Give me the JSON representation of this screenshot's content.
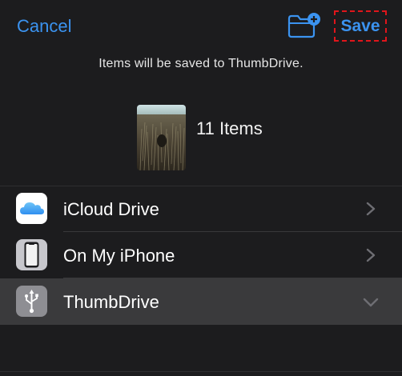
{
  "nav": {
    "cancel_label": "Cancel",
    "save_label": "Save",
    "new_folder_icon": "folder-plus-icon",
    "accent_color": "#3b93f0",
    "highlight_color": "#e0151b"
  },
  "subtitle": "Items will be saved to ThumbDrive.",
  "preview": {
    "items_label": "11 Items"
  },
  "locations": [
    {
      "label": "iCloud Drive",
      "icon": "icloud-icon",
      "indicator": "chevron-right-icon",
      "selected": false
    },
    {
      "label": "On My iPhone",
      "icon": "iphone-icon",
      "indicator": "chevron-right-icon",
      "selected": false
    },
    {
      "label": "ThumbDrive",
      "icon": "usb-icon",
      "indicator": "chevron-down-icon",
      "selected": true
    }
  ]
}
